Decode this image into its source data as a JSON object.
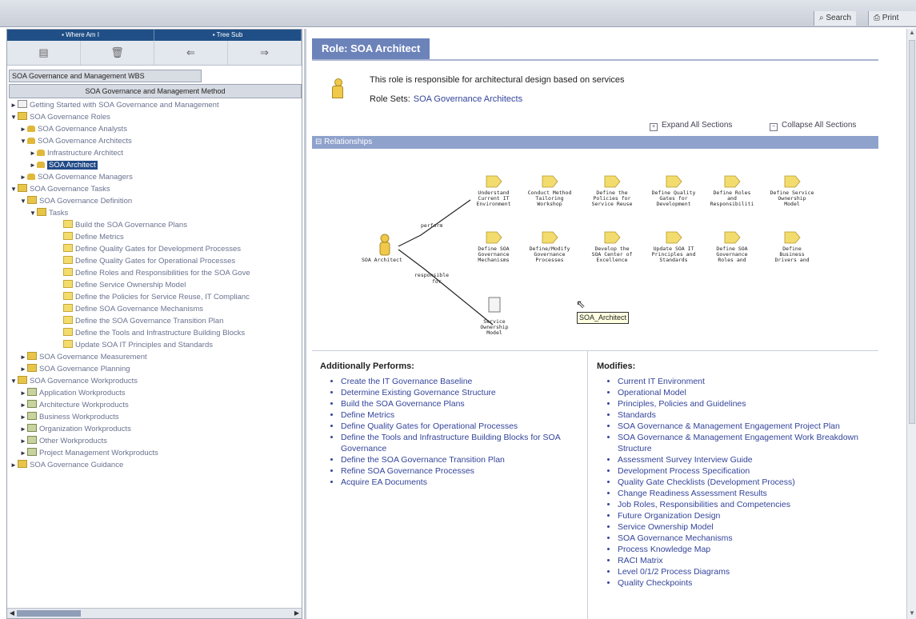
{
  "topbar": {
    "search_label": "Search",
    "print_label": "Print"
  },
  "left": {
    "tabs": [
      "Where Am I",
      "Tree Sub"
    ],
    "wbs_tab": "SOA Governance and Management WBS",
    "method_title": "SOA Governance and Management Method",
    "tree": [
      {
        "label": "Getting Started with SOA Governance and Management",
        "level": 0,
        "icon": "doc-icon",
        "twisty": "collapsed"
      },
      {
        "label": "SOA Governance Roles",
        "level": 0,
        "icon": "folder-icon",
        "twisty": "expanded"
      },
      {
        "label": "SOA Governance Analysts",
        "level": 1,
        "icon": "role-group-icon",
        "twisty": "collapsed"
      },
      {
        "label": "SOA Governance Architects",
        "level": 1,
        "icon": "role-group-icon",
        "twisty": "expanded"
      },
      {
        "label": "Infrastructure Architect",
        "level": 2,
        "icon": "role-icon",
        "twisty": "collapsed"
      },
      {
        "label": "SOA Architect",
        "level": 2,
        "icon": "role-icon",
        "twisty": "collapsed",
        "selected": true
      },
      {
        "label": "SOA Governance Managers",
        "level": 1,
        "icon": "role-group-icon",
        "twisty": "collapsed"
      },
      {
        "label": "SOA Governance Tasks",
        "level": 0,
        "icon": "folder-icon",
        "twisty": "expanded"
      },
      {
        "label": "SOA Governance Definition",
        "level": 1,
        "icon": "folder-icon",
        "twisty": "expanded"
      },
      {
        "label": "Tasks",
        "level": 2,
        "icon": "folder-icon",
        "twisty": "expanded"
      },
      {
        "label": "Build the SOA Governance Plans",
        "level": 3,
        "icon": "task-icon"
      },
      {
        "label": "Define Metrics",
        "level": 3,
        "icon": "task-icon"
      },
      {
        "label": "Define Quality Gates for Development Processes",
        "level": 3,
        "icon": "task-icon"
      },
      {
        "label": "Define Quality Gates for Operational Processes",
        "level": 3,
        "icon": "task-icon"
      },
      {
        "label": "Define Roles and Responsibilities for the SOA Gove",
        "level": 3,
        "icon": "task-icon"
      },
      {
        "label": "Define Service Ownership Model",
        "level": 3,
        "icon": "task-icon"
      },
      {
        "label": "Define the Policies for Service Reuse, IT Complianc",
        "level": 3,
        "icon": "task-icon"
      },
      {
        "label": "Define SOA Governance Mechanisms",
        "level": 3,
        "icon": "task-icon"
      },
      {
        "label": "Define the SOA Governance Transition Plan",
        "level": 3,
        "icon": "task-icon"
      },
      {
        "label": "Define the Tools and Infrastructure Building Blocks",
        "level": 3,
        "icon": "task-icon"
      },
      {
        "label": "Update SOA IT Principles and Standards",
        "level": 3,
        "icon": "task-icon"
      },
      {
        "label": "SOA Governance Measurement",
        "level": 1,
        "icon": "folder-icon",
        "twisty": "collapsed"
      },
      {
        "label": "SOA Governance Planning",
        "level": 1,
        "icon": "folder-icon",
        "twisty": "collapsed"
      },
      {
        "label": "SOA Governance Workproducts",
        "level": 0,
        "icon": "folder-icon",
        "twisty": "expanded"
      },
      {
        "label": "Application Workproducts",
        "level": 1,
        "icon": "workproduct-icon",
        "twisty": "collapsed"
      },
      {
        "label": "Architecture Workproducts",
        "level": 1,
        "icon": "workproduct-icon",
        "twisty": "collapsed"
      },
      {
        "label": "Business Workproducts",
        "level": 1,
        "icon": "workproduct-icon",
        "twisty": "collapsed"
      },
      {
        "label": "Organization Workproducts",
        "level": 1,
        "icon": "workproduct-icon",
        "twisty": "collapsed"
      },
      {
        "label": "Other Workproducts",
        "level": 1,
        "icon": "workproduct-icon",
        "twisty": "collapsed"
      },
      {
        "label": "Project Management Workproducts",
        "level": 1,
        "icon": "workproduct-icon",
        "twisty": "collapsed"
      },
      {
        "label": "SOA Governance Guidance",
        "level": 0,
        "icon": "folder-icon",
        "twisty": "collapsed"
      }
    ]
  },
  "main": {
    "role_title": "Role: SOA Architect",
    "description": "This role is responsible for architectural design based on services",
    "role_sets_label": "Role Sets:",
    "role_sets_link": "SOA Governance Architects",
    "expand_all": "Expand All Sections",
    "collapse_all": "Collapse All Sections",
    "relationships_title": "Relationships",
    "diagram": {
      "role_label": "SOA Architect",
      "perform_label": "perform",
      "responsible_label": "responsible for",
      "tasks_row1": [
        [
          "Understand",
          "Current IT",
          "Environment"
        ],
        [
          "Conduct Method",
          "Tailoring",
          "Workshop"
        ],
        [
          "Define the",
          "Policies for",
          "Service Reuse"
        ],
        [
          "Define Quality",
          "Gates for",
          "Development"
        ],
        [
          "Define Roles",
          "and",
          "Responsibiliti"
        ],
        [
          "Define Service",
          "Ownership",
          "Model"
        ]
      ],
      "tasks_row2": [
        [
          "Define SOA",
          "Governance",
          "Mechanisms"
        ],
        [
          "Define/Modify",
          "Governance",
          "Processes"
        ],
        [
          "Develop the",
          "SOA Center of",
          "Excellence"
        ],
        [
          "Update SOA IT",
          "Principles and",
          "Standards"
        ],
        [
          "Define SOA",
          "Governance",
          "Roles and"
        ],
        [
          "Define",
          "Business",
          "Drivers and"
        ]
      ],
      "workproduct": [
        "Service",
        "Ownership",
        "Model"
      ],
      "tooltip": "SOA_Architect"
    },
    "additionally_performs": {
      "title": "Additionally Performs:",
      "items": [
        "Create the IT Governance Baseline",
        "Determine Existing Governance Structure",
        "Build the SOA Governance Plans",
        "Define Metrics",
        "Define Quality Gates for Operational Processes",
        "Define the Tools and Infrastructure Building Blocks for SOA Governance",
        "Define the SOA Governance Transition Plan",
        "Refine SOA Governance Processes",
        "Acquire EA Documents"
      ]
    },
    "modifies": {
      "title": "Modifies:",
      "items": [
        "Current IT Environment",
        "Operational Model",
        "Principles, Policies and Guidelines",
        "Standards",
        "SOA Governance & Management Engagement Project Plan",
        "SOA Governance & Management Engagement Work Breakdown Structure",
        "Assessment Survey Interview Guide",
        "Development Process Specification",
        "Quality Gate Checklists (Development Process)",
        "Change Readiness Assessment Results",
        "Job Roles, Responsibilities and Competencies",
        "Future Organization Design",
        "Service Ownership Model",
        "SOA Governance Mechanisms",
        "Process Knowledge Map",
        "RACI Matrix",
        "Level 0/1/2 Process Diagrams",
        "Quality Checkpoints"
      ]
    }
  }
}
